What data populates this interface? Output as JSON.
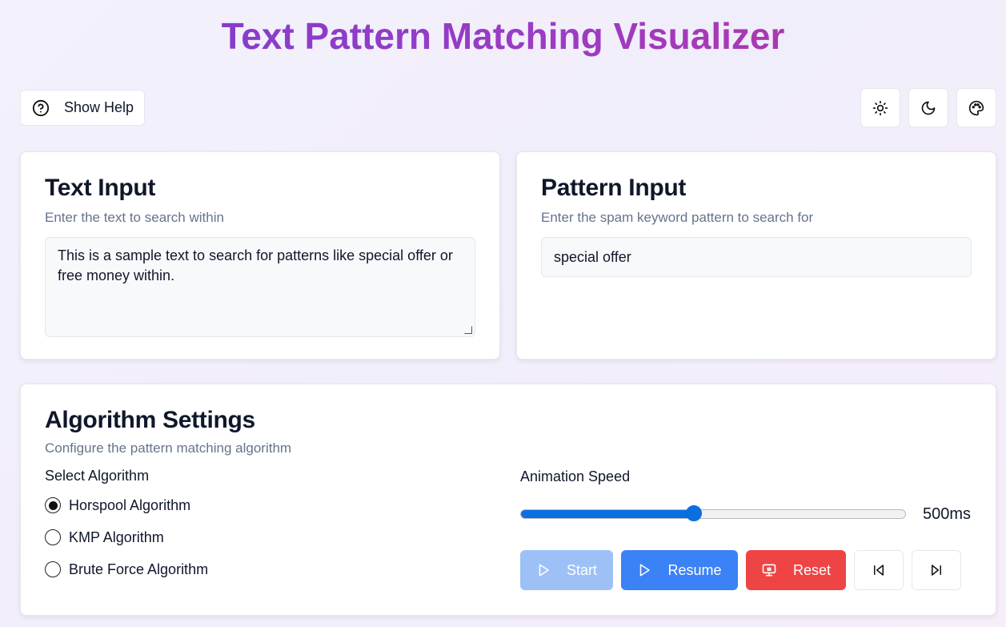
{
  "title": "Text Pattern Matching Visualizer",
  "toolbar": {
    "help_label": "Show Help",
    "icons": [
      "sun-icon",
      "moon-icon",
      "palette-icon"
    ]
  },
  "text_input": {
    "heading": "Text Input",
    "description": "Enter the text to search within",
    "value": "This is a sample text to search for patterns like special offer or free money within."
  },
  "pattern_input": {
    "heading": "Pattern Input",
    "description": "Enter the spam keyword pattern to search for",
    "value": "special offer"
  },
  "algorithm": {
    "heading": "Algorithm Settings",
    "description": "Configure the pattern matching algorithm",
    "select_label": "Select Algorithm",
    "options": [
      {
        "label": "Horspool Algorithm",
        "checked": true
      },
      {
        "label": "KMP Algorithm",
        "checked": false
      },
      {
        "label": "Brute Force Algorithm",
        "checked": false
      }
    ],
    "speed_label": "Animation Speed",
    "speed_fraction": 0.45,
    "speed_value": "500ms",
    "buttons": {
      "start": "Start",
      "resume": "Resume",
      "reset": "Reset"
    }
  },
  "colors": {
    "primary": "#3b82f6",
    "primary_disabled": "#9dc1f7",
    "danger": "#ef4444",
    "slider": "#0b6fe0"
  }
}
